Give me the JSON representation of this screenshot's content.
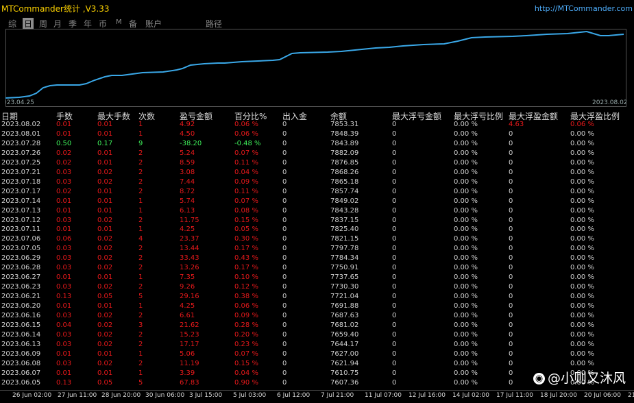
{
  "window": {
    "title": "MTCommander统计 ,V3.33",
    "url": "http://MTCommander.com"
  },
  "tabs": [
    "综",
    "日",
    "周",
    "月",
    "季",
    "年",
    "币",
    "M",
    "备",
    "账户",
    "路径"
  ],
  "active_tab": "日",
  "equity_chart": {
    "start_label": "023.04.25",
    "end_label": "2023.08.02",
    "line_color": "#3aa8e8"
  },
  "table": {
    "headers": [
      "日期",
      "手数",
      "最大手数",
      "次数",
      "盈亏金额",
      "百分比%",
      "出入金",
      "余额",
      "最大浮亏金额",
      "最大浮亏比例",
      "最大浮盈金额",
      "最大浮盈比例"
    ],
    "rows": [
      [
        "2023.08.02",
        "0.01",
        "0.01",
        "1",
        "4.92",
        "0.06 %",
        "0",
        "7853.31",
        "0",
        "0.00 %",
        "4.63",
        "0.06 %"
      ],
      [
        "2023.08.01",
        "0.01",
        "0.01",
        "1",
        "4.50",
        "0.06 %",
        "0",
        "7848.39",
        "0",
        "0.00 %",
        "0",
        "0.00 %"
      ],
      [
        "2023.07.28",
        "0.50",
        "0.17",
        "9",
        "-38.20",
        "-0.48 %",
        "0",
        "7843.89",
        "0",
        "0.00 %",
        "0",
        "0.00 %"
      ],
      [
        "2023.07.26",
        "0.02",
        "0.01",
        "2",
        "5.24",
        "0.07 %",
        "0",
        "7882.09",
        "0",
        "0.00 %",
        "0",
        "0.00 %"
      ],
      [
        "2023.07.25",
        "0.02",
        "0.01",
        "2",
        "8.59",
        "0.11 %",
        "0",
        "7876.85",
        "0",
        "0.00 %",
        "0",
        "0.00 %"
      ],
      [
        "2023.07.21",
        "0.03",
        "0.02",
        "2",
        "3.08",
        "0.04 %",
        "0",
        "7868.26",
        "0",
        "0.00 %",
        "0",
        "0.00 %"
      ],
      [
        "2023.07.18",
        "0.03",
        "0.02",
        "2",
        "7.44",
        "0.09 %",
        "0",
        "7865.18",
        "0",
        "0.00 %",
        "0",
        "0.00 %"
      ],
      [
        "2023.07.17",
        "0.02",
        "0.01",
        "2",
        "8.72",
        "0.11 %",
        "0",
        "7857.74",
        "0",
        "0.00 %",
        "0",
        "0.00 %"
      ],
      [
        "2023.07.14",
        "0.01",
        "0.01",
        "1",
        "5.74",
        "0.07 %",
        "0",
        "7849.02",
        "0",
        "0.00 %",
        "0",
        "0.00 %"
      ],
      [
        "2023.07.13",
        "0.01",
        "0.01",
        "1",
        "6.13",
        "0.08 %",
        "0",
        "7843.28",
        "0",
        "0.00 %",
        "0",
        "0.00 %"
      ],
      [
        "2023.07.12",
        "0.03",
        "0.02",
        "2",
        "11.75",
        "0.15 %",
        "0",
        "7837.15",
        "0",
        "0.00 %",
        "0",
        "0.00 %"
      ],
      [
        "2023.07.11",
        "0.01",
        "0.01",
        "1",
        "4.25",
        "0.05 %",
        "0",
        "7825.40",
        "0",
        "0.00 %",
        "0",
        "0.00 %"
      ],
      [
        "2023.07.06",
        "0.06",
        "0.02",
        "4",
        "23.37",
        "0.30 %",
        "0",
        "7821.15",
        "0",
        "0.00 %",
        "0",
        "0.00 %"
      ],
      [
        "2023.07.05",
        "0.03",
        "0.02",
        "2",
        "13.44",
        "0.17 %",
        "0",
        "7797.78",
        "0",
        "0.00 %",
        "0",
        "0.00 %"
      ],
      [
        "2023.06.29",
        "0.03",
        "0.02",
        "2",
        "33.43",
        "0.43 %",
        "0",
        "7784.34",
        "0",
        "0.00 %",
        "0",
        "0.00 %"
      ],
      [
        "2023.06.28",
        "0.03",
        "0.02",
        "2",
        "13.26",
        "0.17 %",
        "0",
        "7750.91",
        "0",
        "0.00 %",
        "0",
        "0.00 %"
      ],
      [
        "2023.06.27",
        "0.01",
        "0.01",
        "1",
        "7.35",
        "0.10 %",
        "0",
        "7737.65",
        "0",
        "0.00 %",
        "0",
        "0.00 %"
      ],
      [
        "2023.06.23",
        "0.03",
        "0.02",
        "2",
        "9.26",
        "0.12 %",
        "0",
        "7730.30",
        "0",
        "0.00 %",
        "0",
        "0.00 %"
      ],
      [
        "2023.06.21",
        "0.13",
        "0.05",
        "5",
        "29.16",
        "0.38 %",
        "0",
        "7721.04",
        "0",
        "0.00 %",
        "0",
        "0.00 %"
      ],
      [
        "2023.06.20",
        "0.01",
        "0.01",
        "1",
        "4.25",
        "0.06 %",
        "0",
        "7691.88",
        "0",
        "0.00 %",
        "0",
        "0.00 %"
      ],
      [
        "2023.06.16",
        "0.03",
        "0.02",
        "2",
        "6.61",
        "0.09 %",
        "0",
        "7687.63",
        "0",
        "0.00 %",
        "0",
        "0.00 %"
      ],
      [
        "2023.06.15",
        "0.04",
        "0.02",
        "3",
        "21.62",
        "0.28 %",
        "0",
        "7681.02",
        "0",
        "0.00 %",
        "0",
        "0.00 %"
      ],
      [
        "2023.06.14",
        "0.03",
        "0.02",
        "2",
        "15.23",
        "0.20 %",
        "0",
        "7659.40",
        "0",
        "0.00 %",
        "0",
        "0.00 %"
      ],
      [
        "2023.06.13",
        "0.03",
        "0.02",
        "2",
        "17.17",
        "0.23 %",
        "0",
        "7644.17",
        "0",
        "0.00 %",
        "0",
        "0.00 %"
      ],
      [
        "2023.06.09",
        "0.01",
        "0.01",
        "1",
        "5.06",
        "0.07 %",
        "0",
        "7627.00",
        "0",
        "0.00 %",
        "0",
        "0.00 %"
      ],
      [
        "2023.06.08",
        "0.03",
        "0.02",
        "2",
        "11.19",
        "0.15 %",
        "0",
        "7621.94",
        "0",
        "0.00 %",
        "0",
        "0.00 %"
      ],
      [
        "2023.06.07",
        "0.01",
        "0.01",
        "1",
        "3.39",
        "0.04 %",
        "0",
        "7610.75",
        "0",
        "0.00 %",
        "0",
        "0.00 %"
      ],
      [
        "2023.06.05",
        "0.13",
        "0.05",
        "5",
        "67.83",
        "0.90 %",
        "0",
        "7607.36",
        "0",
        "0.00 %",
        "0",
        "0.00 %"
      ]
    ]
  },
  "time_axis": [
    "26 Jun 02:00",
    "27 Jun 11:00",
    "28 Jun 20:00",
    "30 Jun 06:00",
    "3 Jul 15:00",
    "5 Jul 03:00",
    "6 Jul 12:00",
    "7 Jul 21:00",
    "11 Jul 07:00",
    "12 Jul 16:00",
    "14 Jul 02:00",
    "17 Jul 11:00",
    "18 Jul 20:00",
    "20 Jul 06:00",
    "21"
  ],
  "watermark": "@小则又沐风",
  "colors": {
    "profit": "#e8191b",
    "loss": "#3ef05a",
    "title": "#ffd400",
    "link": "#4fb0ff"
  }
}
